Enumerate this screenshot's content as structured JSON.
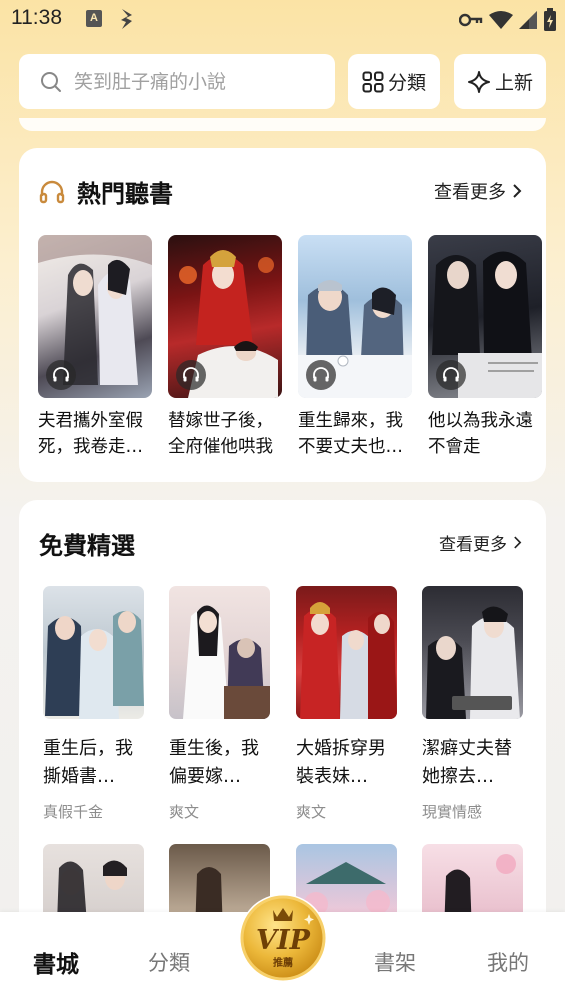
{
  "status_bar": {
    "time": "11:38",
    "notification_icon_letter": "A"
  },
  "search": {
    "placeholder": "笑到肚子痛的小說"
  },
  "top_buttons": {
    "category_label": "分類",
    "new_label": "上新"
  },
  "audio_section": {
    "title": "熱門聽書",
    "more_label": "查看更多",
    "books": [
      {
        "title": "夫君攜外室假死，我卷走…"
      },
      {
        "title": "替嫁世子後，全府催他哄我"
      },
      {
        "title": "重生歸來，我不要丈夫也…"
      },
      {
        "title": "他以為我永遠不會走"
      }
    ]
  },
  "free_section": {
    "title": "免費精選",
    "more_label": "查看更多",
    "books": [
      {
        "title": "重生后，我撕婚書…",
        "tag": "真假千金"
      },
      {
        "title": "重生後，我偏要嫁…",
        "tag": "爽文"
      },
      {
        "title": "大婚拆穿男裝表妹…",
        "tag": "爽文"
      },
      {
        "title": "潔癖丈夫替她擦去…",
        "tag": "現實情感"
      }
    ]
  },
  "bottom_nav": {
    "items": [
      "書城",
      "分類",
      "書架",
      "我的"
    ],
    "vip_label": "VIP",
    "vip_sub": "推薦"
  },
  "colors": {
    "accent": "#f3c560",
    "vip_gold": "#e9b736",
    "vip_dark": "#7a4a08"
  }
}
